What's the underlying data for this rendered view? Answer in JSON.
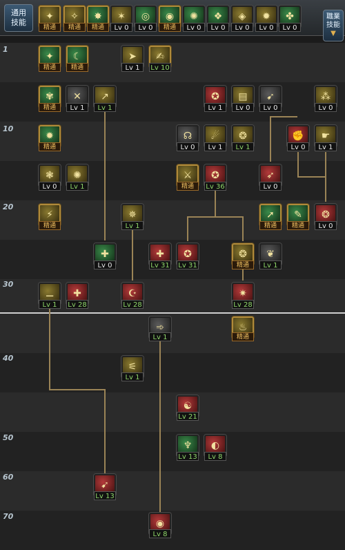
{
  "tabs": {
    "common": "通用\n技能",
    "exclusive": "職業\n技能"
  },
  "level_labels": [
    "1",
    "10",
    "20",
    "30",
    "40",
    "50",
    "60",
    "70"
  ],
  "badges": {
    "top": [
      "精通",
      "精通",
      "精通",
      "Lv 0",
      "Lv 0",
      "精通",
      "Lv 0",
      "Lv 0",
      "Lv 0",
      "Lv 0",
      "Lv 0"
    ],
    "r1": [
      "精通",
      "精通",
      "Lv 1",
      "Lv 10"
    ],
    "r2": [
      "精通",
      "Lv 1",
      "Lv 1",
      "Lv 1",
      "Lv 0",
      "Lv 0",
      "Lv 0"
    ],
    "r3": [
      "精通",
      "Lv 0",
      "Lv 1",
      "Lv 1",
      "Lv 0",
      "Lv 1"
    ],
    "r4": [
      "Lv 0",
      "Lv 1",
      "精通",
      "Lv 36",
      "Lv 0"
    ],
    "r5": [
      "精通",
      "Lv 1",
      "精通",
      "精通",
      "Lv 0"
    ],
    "r6": [
      "Lv 0",
      "Lv 31",
      "Lv 31",
      "精通",
      "Lv 1"
    ],
    "r7": [
      "Lv 1",
      "Lv 28",
      "Lv 28",
      "Lv 28"
    ],
    "r8": [
      "Lv 1",
      "精通"
    ],
    "r9": [
      "Lv 1"
    ],
    "r10": [
      "Lv 21"
    ],
    "r11": [
      "Lv 13",
      "Lv 8"
    ],
    "r12": [
      "Lv 13"
    ],
    "r13": [
      "Lv 8"
    ]
  }
}
